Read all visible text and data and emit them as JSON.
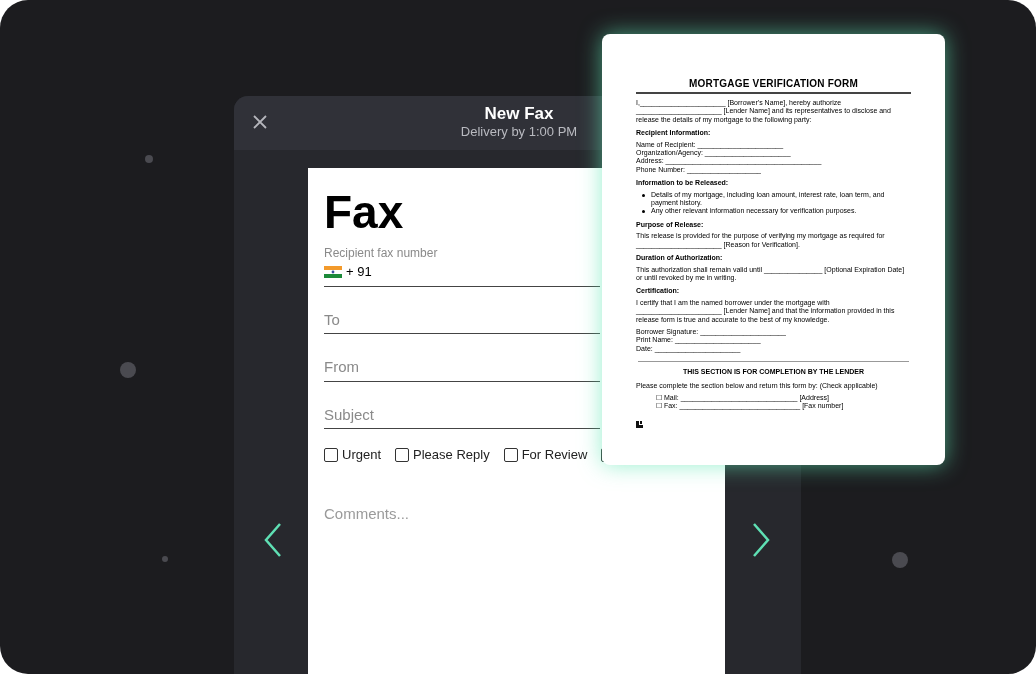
{
  "fax_window": {
    "title": "New Fax",
    "subtitle": "Delivery by 1:00 PM"
  },
  "fax_form": {
    "heading": "Fax",
    "recipient_label": "Recipient fax number",
    "country_code": "+ 91",
    "fields": [
      {
        "placeholder": "To"
      },
      {
        "placeholder": "From"
      },
      {
        "placeholder": "Subject"
      }
    ],
    "checkboxes": [
      {
        "label": "Urgent",
        "checked": false
      },
      {
        "label": "Please Reply",
        "checked": false
      },
      {
        "label": "For Review",
        "checked": false
      },
      {
        "checked": false
      }
    ],
    "comments": {
      "placeholder": "Comments..."
    }
  },
  "document": {
    "title": "MORTGAGE VERIFICATION FORM",
    "sections": [
      {
        "kind": "paragraph",
        "text": "I,______________________ [Borrower's Name], hereby authorize ______________________ [Lender Name] and its representatives to disclose and release the details of my mortgage to the following party:"
      },
      {
        "kind": "heading",
        "text": "Recipient Information:"
      },
      {
        "kind": "line",
        "text": "Name of Recipient: ______________________"
      },
      {
        "kind": "line",
        "text": "Organization/Agency: ______________________"
      },
      {
        "kind": "line",
        "text": "Address: ________________________________________"
      },
      {
        "kind": "line",
        "text": "Phone Number: ___________________"
      },
      {
        "kind": "heading",
        "text": "Information to be Released:"
      },
      {
        "kind": "bullet",
        "text": "Details of my mortgage, including loan amount, interest rate, loan term, and payment history."
      },
      {
        "kind": "bullet",
        "text": "Any other relevant information necessary for verification purposes."
      },
      {
        "kind": "heading",
        "text": "Purpose of Release:"
      },
      {
        "kind": "paragraph",
        "text": "This release is provided for the purpose of verifying my mortgage as required for ______________________ [Reason for Verification]."
      },
      {
        "kind": "heading",
        "text": "Duration of Authorization:"
      },
      {
        "kind": "paragraph",
        "text": "This authorization shall remain valid until _______________ [Optional Expiration Date] or until revoked by me in writing."
      },
      {
        "kind": "heading",
        "text": "Certification:"
      },
      {
        "kind": "paragraph",
        "text": "I certify that I am the named borrower under the mortgage with ______________________ [Lender Name] and that the information provided in this release form is true and accurate to the best of my knowledge."
      },
      {
        "kind": "line",
        "text": "Borrower Signature: ______________________"
      },
      {
        "kind": "line",
        "text": "Print Name: ______________________"
      },
      {
        "kind": "line",
        "text": "Date: ______________________"
      },
      {
        "kind": "rule"
      },
      {
        "kind": "centered_heading",
        "text": "THIS SECTION IS FOR COMPLETION BY THE LENDER"
      },
      {
        "kind": "paragraph",
        "text": "Please complete the section below and return this form by: (Check applicable)"
      },
      {
        "kind": "option",
        "text": "☐ Mail: ______________________________ [Address]"
      },
      {
        "kind": "option",
        "text": "☐ Fax: _______________________________ [Fax number]"
      },
      {
        "kind": "logo"
      }
    ]
  }
}
